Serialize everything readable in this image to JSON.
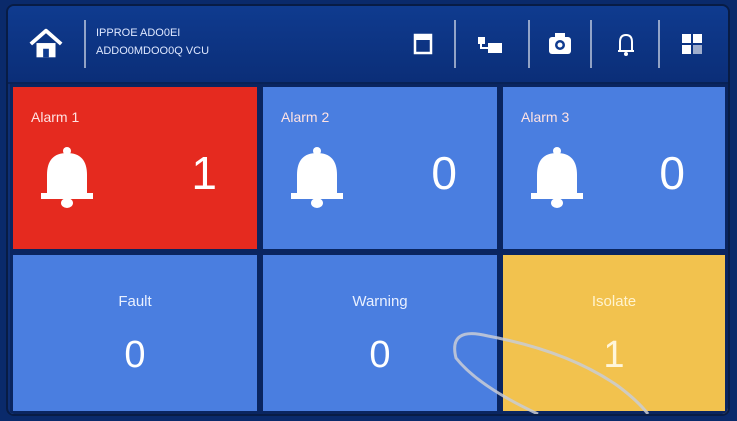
{
  "header": {
    "line1": "IPPROE ADO0EI",
    "line2": "ADDO0MDOO0Q VCU",
    "icons": {
      "home": "home-icon",
      "calendar": "calendar-icon",
      "network": "network-icon",
      "camera": "camera-icon",
      "bell": "bell-icon",
      "grid": "grid-icon"
    }
  },
  "alarms": [
    {
      "label": "Alarm 1",
      "count": "1",
      "color": "#e52a1f"
    },
    {
      "label": "Alarm 2",
      "count": "0",
      "color": "#4a7ee0"
    },
    {
      "label": "Alarm 3",
      "count": "0",
      "color": "#4a7ee0"
    }
  ],
  "stats": [
    {
      "label": "Fault",
      "count": "0",
      "color": "#4a7ee0"
    },
    {
      "label": "Warning",
      "count": "0",
      "color": "#4a7ee0"
    },
    {
      "label": "Isolate",
      "count": "1",
      "color": "#f2c24e"
    }
  ]
}
